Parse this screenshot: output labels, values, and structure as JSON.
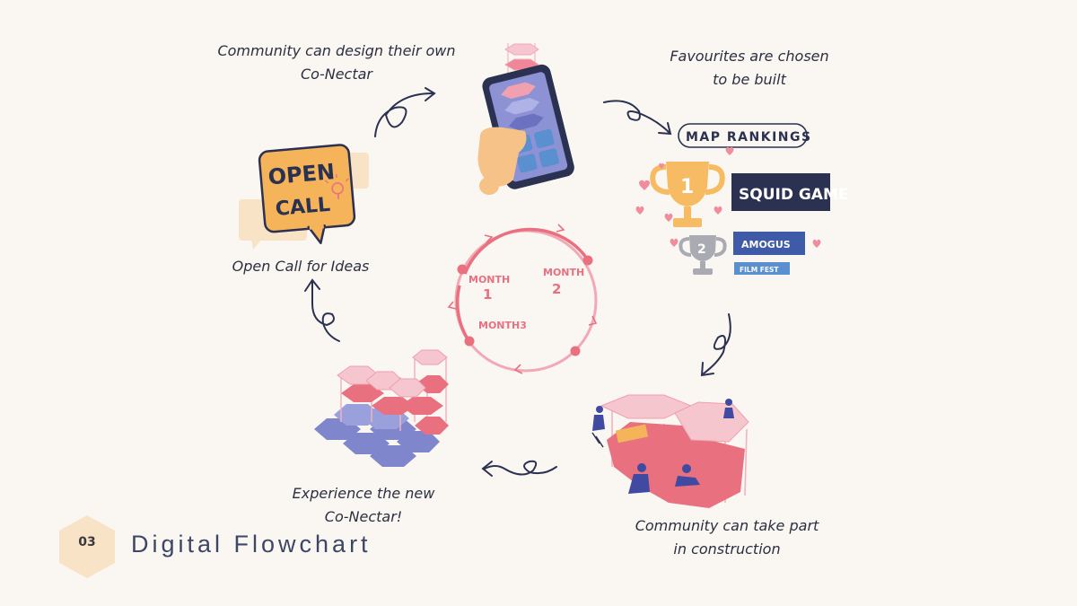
{
  "steps": {
    "design": {
      "line1": "Community can design their own",
      "line2": "Co-Nectar"
    },
    "favourites": {
      "line1": "Favourites are chosen",
      "line2": "to be built"
    },
    "construction": {
      "line1": "Community can take part",
      "line2": "in construction"
    },
    "experience": {
      "line1": "Experience the new",
      "line2": "Co-Nectar!"
    },
    "open_call": {
      "line1": "Open Call for Ideas"
    }
  },
  "open_call_sign": {
    "line1": "OPEN",
    "line2": "CALL"
  },
  "rankings": {
    "title": "MAP RANKINGS",
    "first": {
      "rank": "1",
      "label": "SQUID GAME"
    },
    "second": {
      "rank": "2",
      "label": "AMOGUS"
    },
    "third": {
      "label": "FILM FEST"
    }
  },
  "cycle": {
    "month1": {
      "word": "MONTH",
      "num": "1"
    },
    "month2": {
      "word": "MONTH",
      "num": "2"
    },
    "month3": {
      "word": "MONTH3"
    }
  },
  "footer": {
    "number": "03",
    "title": "Digital Flowchart"
  },
  "colors": {
    "navy": "#2b3150",
    "pink": "#e8707f",
    "light_pink": "#f6c6cf",
    "periwinkle": "#7f86cc",
    "gold": "#f5b35a",
    "cream": "#f8e3c6",
    "background": "#faf7f3"
  }
}
